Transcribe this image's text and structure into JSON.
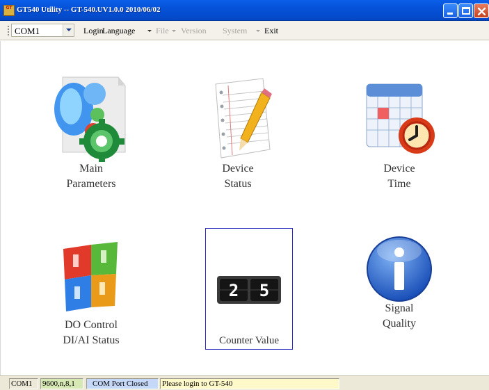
{
  "window": {
    "title": "GT540 Utility -- GT-540.UV1.0.0 2010/06/02",
    "icon_text": "GT"
  },
  "menu": {
    "port_combo_value": "COM1",
    "items": [
      {
        "label": "Login",
        "enabled": true,
        "dropdown": false
      },
      {
        "label": "Language",
        "enabled": true,
        "dropdown": true
      },
      {
        "label": "File",
        "enabled": false,
        "dropdown": true
      },
      {
        "label": "Version",
        "enabled": false,
        "dropdown": false
      },
      {
        "label": "System",
        "enabled": false,
        "dropdown": true
      },
      {
        "label": "Exit",
        "enabled": true,
        "dropdown": false
      }
    ]
  },
  "tiles": {
    "main_parameters": {
      "line1": "Main",
      "line2": "Parameters",
      "icon": "gear-globe-icon"
    },
    "device_status": {
      "line1": "Device",
      "line2": "Status",
      "icon": "notepad-pencil-icon"
    },
    "device_time": {
      "line1": "Device",
      "line2": "Time",
      "icon": "calendar-clock-icon"
    },
    "do_control": {
      "line1": "DO Control",
      "line2": "DI/AI Status",
      "icon": "switch-blocks-icon"
    },
    "counter_value": {
      "line1": "Counter Value",
      "digits": "25",
      "icon": "counter-digits-icon",
      "selected": true
    },
    "signal_quality": {
      "line1": "Signal",
      "line2": "Quality",
      "icon": "info-icon"
    }
  },
  "statusbar": {
    "port": "COM1",
    "settings": "9600,n,8,1",
    "port_state": "COM Port Closed",
    "message": "Please login to GT-540"
  },
  "colors": {
    "titlebar": "#0652d8",
    "menubar": "#f3f1ea",
    "status_settings_bg": "#d6e8b4",
    "status_port_state_bg": "#c6d8f8",
    "status_message_bg": "#fff8c8",
    "selection_border": "#2b2bc0"
  }
}
